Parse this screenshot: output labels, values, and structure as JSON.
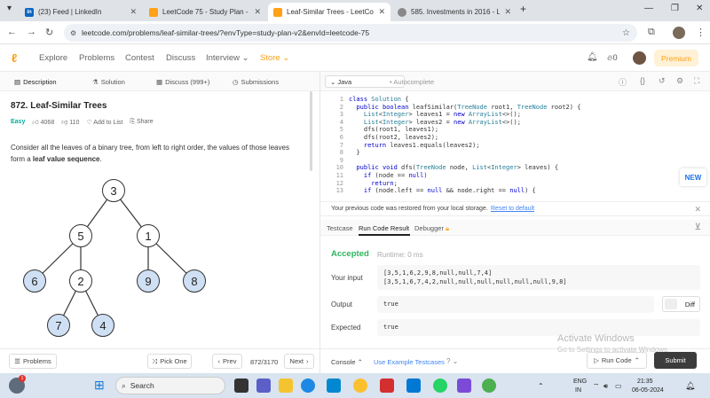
{
  "browser": {
    "tabs": [
      {
        "icon": "in",
        "title": "(23) Feed | LinkedIn"
      },
      {
        "icon": "LC",
        "title": "LeetCode 75 - Study Plan - Leet"
      },
      {
        "icon": "LC",
        "title": "Leaf-Similar Trees - LeetCode"
      },
      {
        "icon": "585",
        "title": "585. Investments in 2016 - Leet"
      }
    ],
    "new_tab": "+",
    "url": "leetcode.com/problems/leaf-similar-trees/?envType=study-plan-v2&envId=leetcode-75"
  },
  "nav": {
    "links": [
      "Explore",
      "Problems",
      "Contest",
      "Discuss",
      "Interview",
      "Store"
    ],
    "notif_count": "0",
    "premium": "Premium"
  },
  "left_tabs": [
    "Description",
    "Solution",
    "Discuss (999+)",
    "Submissions"
  ],
  "problem": {
    "title": "872. Leaf-Similar Trees",
    "difficulty": "Easy",
    "likes": "4068",
    "dislikes": "110",
    "add_to_list": "Add to List",
    "share": "Share",
    "desc_before": "Consider all the leaves of a binary tree, from left to right order, the values of those leaves form a ",
    "desc_bold": "leaf value sequence",
    "desc_after": "."
  },
  "tree": {
    "nodes": [
      {
        "v": "3",
        "leaf": false
      },
      {
        "v": "5",
        "leaf": false
      },
      {
        "v": "1",
        "leaf": false
      },
      {
        "v": "6",
        "leaf": true
      },
      {
        "v": "2",
        "leaf": false
      },
      {
        "v": "9",
        "leaf": true
      },
      {
        "v": "8",
        "leaf": true
      },
      {
        "v": "7",
        "leaf": true
      },
      {
        "v": "4",
        "leaf": true
      }
    ]
  },
  "bottom_left": {
    "problems": "Problems",
    "pick_one": "Pick One",
    "prev": "Prev",
    "counter": "872/3170",
    "next": "Next"
  },
  "editor": {
    "language": "Java",
    "autocomplete": "Autocomplete",
    "lines": [
      "class Solution {",
      "  public boolean leafSimilar(TreeNode root1, TreeNode root2) {",
      "    List<Integer> leaves1 = new ArrayList<>();",
      "    List<Integer> leaves2 = new ArrayList<>();",
      "    dfs(root1, leaves1);",
      "    dfs(root2, leaves2);",
      "    return leaves1.equals(leaves2);",
      "  }",
      "",
      "  public void dfs(TreeNode node, List<Integer> leaves) {",
      "    if (node == null)",
      "      return;",
      "    if (node.left == null && node.right == null) {"
    ],
    "line_numbers": [
      "1",
      "2",
      "3",
      "4",
      "5",
      "6",
      "7",
      "8",
      "9",
      "10",
      "11",
      "12",
      "13"
    ],
    "restore_msg": "Your previous code was restored from your local storage.",
    "reset_link": "Reset to default"
  },
  "result": {
    "tabs": [
      "Testcase",
      "Run Code Result",
      "Debugger"
    ],
    "status": "Accepted",
    "runtime": "Runtime: 0 ms",
    "input_label": "Your input",
    "input_line1": "[3,5,1,6,2,9,8,null,null,7,4]",
    "input_line2": "[3,5,1,6,7,4,2,null,null,null,null,null,null,9,8]",
    "output_label": "Output",
    "output": "true",
    "expected_label": "Expected",
    "expected": "true",
    "diff": "Diff"
  },
  "bottom_right": {
    "console": "Console",
    "example": "Use Example Testcases",
    "run": "Run Code",
    "submit": "Submit"
  },
  "new_badge": "NEW",
  "watermark": {
    "line1": "Activate Windows",
    "line2": "Go to Settings to activate Windows."
  },
  "taskbar": {
    "search": "Search",
    "lang1": "ENG",
    "lang2": "IN",
    "time": "21:35",
    "date": "06-05-2024"
  }
}
